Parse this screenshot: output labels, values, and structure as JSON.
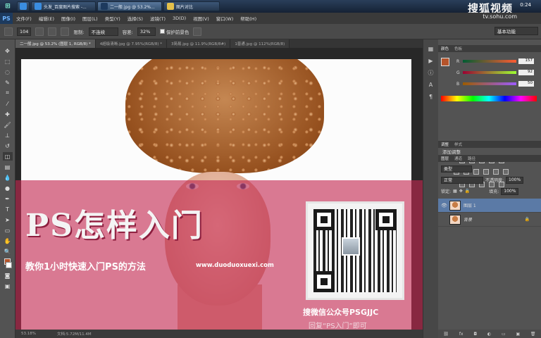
{
  "taskbar": {
    "start_icon": "windows-orb-icon",
    "buttons": [
      {
        "label": "",
        "icon": "ie-icon"
      },
      {
        "label": "头发_百度图片搜索 -...",
        "icon": "ie-icon"
      },
      {
        "label": "二一般.jpg @ 53.2%...",
        "icon": "photoshop-icon",
        "active": true
      },
      {
        "label": "图片对比",
        "icon": "folder-icon"
      }
    ],
    "brand": "搜狐视频",
    "clock": "0:24"
  },
  "menubar": {
    "logo": "PS",
    "items": [
      "文件(F)",
      "编辑(E)",
      "图像(I)",
      "图层(L)",
      "类型(Y)",
      "选择(S)",
      "滤镜(T)",
      "3D(D)",
      "视图(V)",
      "窗口(W)",
      "帮助(H)"
    ],
    "watermark": "tv.sohu.com"
  },
  "options": {
    "brush_size": "104",
    "limit_label": "限制:",
    "limit_value": "不连续",
    "tolerance_label": "容差:",
    "tolerance_value": "32%",
    "protect_label": "保护前景色",
    "workspace": "基本功能"
  },
  "doc_tabs": [
    {
      "label": "二一般.jpg @ 53.2% (图层 1, RGB/8) *",
      "active": true
    },
    {
      "label": "4超级清晰.jpg @ 7.95%(RGB/8) *"
    },
    {
      "label": "3简易.jpg @ 11.9%(RGB/8#)"
    },
    {
      "label": "1普通.jpg @ 112%(RGB/8)"
    }
  ],
  "canvas": {
    "headline": "PS怎样入门",
    "subline": "教你1小时快速入门PS的方法",
    "website": "www.duoduoxuexi.com",
    "qr_caption": "搜微信公众号PSGJJC",
    "qr_caption2": "回复“PS入门”即可"
  },
  "status": {
    "zoom": "53.18%",
    "doc": "文档:5.72M/11.4M"
  },
  "color_panel": {
    "tabs": [
      "颜色",
      "色板"
    ],
    "r_label": "R",
    "r_value": "157",
    "g_label": "G",
    "g_value": "92",
    "b_label": "B",
    "b_value": "50",
    "fg_color": "#9d5c32"
  },
  "adjust_panel": {
    "tabs": [
      "调整",
      "样式"
    ],
    "title": "添加调整"
  },
  "layers_panel": {
    "tabs": [
      "图层",
      "通道",
      "路径"
    ],
    "kind": "类型",
    "blend": "正常",
    "opacity_label": "不透明度:",
    "opacity_value": "100%",
    "lock_label": "锁定:",
    "fill_label": "填充:",
    "fill_value": "100%",
    "layers": [
      {
        "name": "图层 1",
        "selected": true
      },
      {
        "name": "背景",
        "selected": false
      }
    ]
  }
}
